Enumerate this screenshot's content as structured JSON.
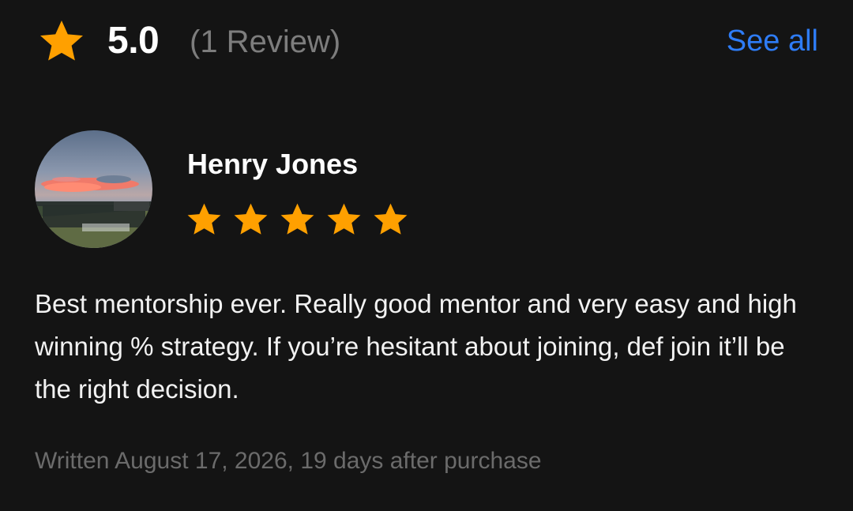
{
  "header": {
    "rating_value": "5.0",
    "review_count_label": "(1 Review)",
    "see_all_label": "See all",
    "star_icon": "star-filled-icon",
    "star_color": "#ffa000",
    "link_color": "#2e7cf6"
  },
  "review": {
    "reviewer_name": "Henry Jones",
    "avatar_icon": "avatar-photo-sunset",
    "rating": 5,
    "max_rating": 5,
    "body": "Best mentorship ever. Really good mentor and very easy and high winning % strategy. If you’re hesitant about joining, def join it’ll be the right decision.",
    "written_meta": "Written August 17, 2026, 19 days after purchase"
  }
}
